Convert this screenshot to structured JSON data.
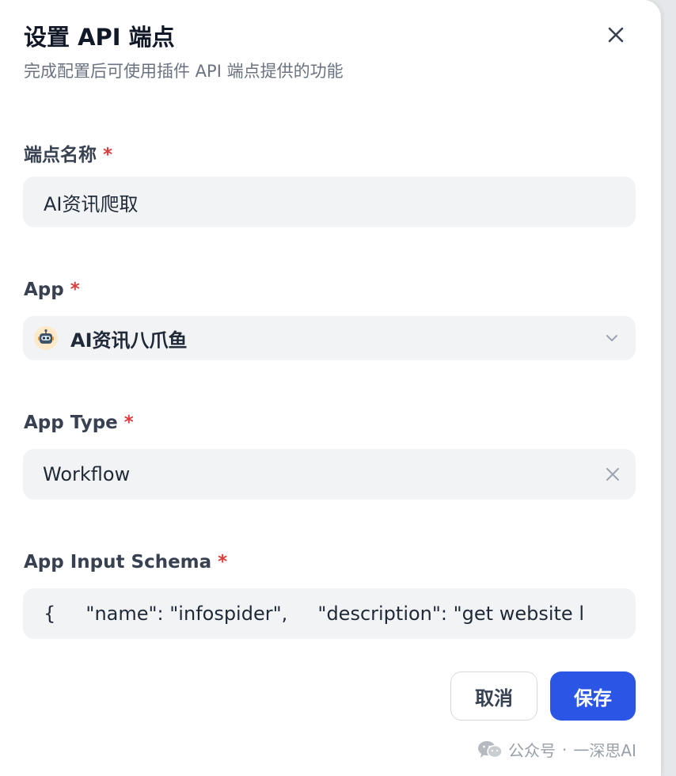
{
  "dialog": {
    "title": "设置 API 端点",
    "subtitle": "完成配置后可使用插件 API 端点提供的功能"
  },
  "fields": {
    "endpoint_name": {
      "label": "端点名称",
      "required_mark": "*",
      "value": "AI资讯爬取"
    },
    "app": {
      "label": "App",
      "required_mark": "*",
      "value": "AI资讯八爪鱼",
      "icon": "robot-icon"
    },
    "app_type": {
      "label": "App Type",
      "required_mark": "*",
      "value": "Workflow"
    },
    "app_input_schema": {
      "label": "App Input Schema",
      "required_mark": "*",
      "value": "{     \"name\": \"infospider\",     \"description\": \"get website l"
    }
  },
  "buttons": {
    "cancel_label": "取消",
    "save_label": "保存"
  },
  "watermark": {
    "source": "公众号",
    "separator": "·",
    "author": "一深思AI",
    "icon": "wechat-icon"
  },
  "colors": {
    "primary": "#2a55e5",
    "required": "#dc3c3c",
    "field_bg": "#f2f3f5",
    "subtitle": "#6b7280"
  }
}
